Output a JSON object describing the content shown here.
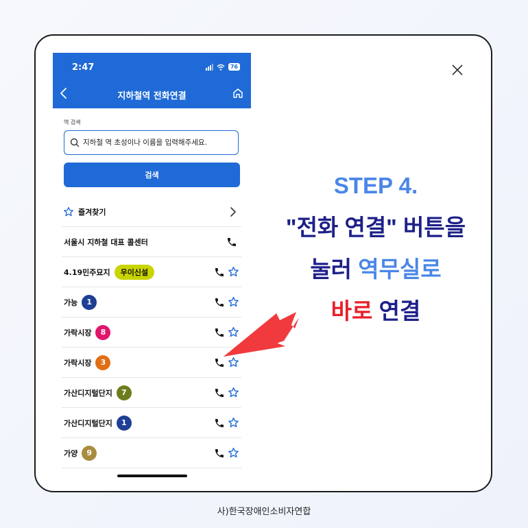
{
  "phone": {
    "time": "2:47",
    "battery": "76",
    "title": "지하철역 전화연결",
    "search_label": "역 검색",
    "search_placeholder": "지하철 역 초성이나 이름을 입력해주세요.",
    "search_button": "검색",
    "favorites_label": "즐겨찾기",
    "call_center": "서울시 지하철 대표 콜센터",
    "stations": [
      {
        "name": "4.19민주묘지",
        "line": "우이신설",
        "color": "#c9d400"
      },
      {
        "name": "가능",
        "line": "1",
        "color": "#1f3e96"
      },
      {
        "name": "가락시장",
        "line": "8",
        "color": "#e0156b"
      },
      {
        "name": "가락시장",
        "line": "3",
        "color": "#e06f14"
      },
      {
        "name": "가산디지털단지",
        "line": "7",
        "color": "#6e7c1d"
      },
      {
        "name": "가산디지털단지",
        "line": "1",
        "color": "#1f3e96"
      },
      {
        "name": "가양",
        "line": "9",
        "color": "#a98c3f"
      }
    ]
  },
  "instruction": {
    "step": "STEP 4.",
    "line2": "\"전화 연결\" 버튼을",
    "line3_a": "눌러",
    "line3_b": "역무실로",
    "line4_a": "바로",
    "line4_b": "연결"
  },
  "footer": "사)한국장애인소비자연합",
  "colors": {
    "app_blue": "#1f6ad6",
    "navy": "#1d2088",
    "light_blue": "#4a86e8",
    "red": "#e8202a",
    "arrow": "#f03a3e"
  },
  "icons": [
    "back-chevron-icon",
    "home-icon",
    "search-icon",
    "star-outline-icon",
    "chevron-right-icon",
    "phone-icon",
    "close-icon",
    "pointer-arrow"
  ]
}
